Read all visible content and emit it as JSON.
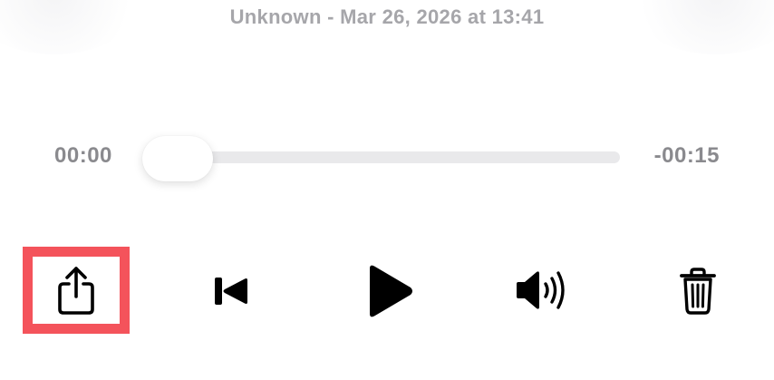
{
  "recording": {
    "subtitle": "Unknown - Mar 26, 2026 at 13:41"
  },
  "playback": {
    "elapsed": "00:00",
    "remaining": "-00:15",
    "progress": 0
  },
  "controls": {
    "share": "share-icon",
    "skip_back": "skip-back-icon",
    "play": "play-icon",
    "volume": "volume-icon",
    "delete": "trash-icon"
  },
  "colors": {
    "highlight": "#f4535b",
    "secondary_text": "#8a8a8e",
    "track": "#e9e9eb"
  }
}
